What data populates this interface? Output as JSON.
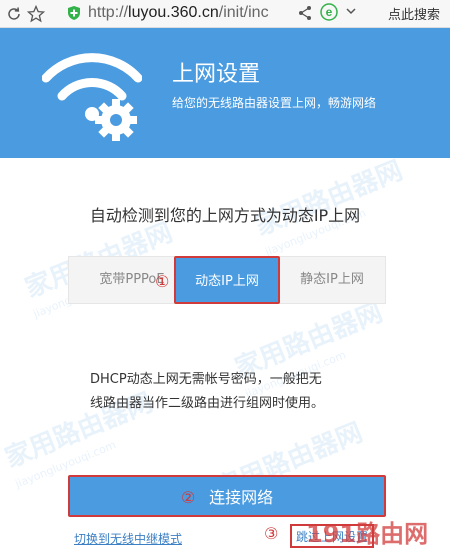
{
  "browser": {
    "url_prefix": "http://",
    "url_host": "luyou.360.cn",
    "url_path": "/init/inc",
    "search_label": "点此搜索",
    "engine_letter": "e"
  },
  "header": {
    "title": "上网设置",
    "subtitle": "给您的无线路由器设置上网，畅游网络"
  },
  "main": {
    "detect_title": "自动检测到您的上网方式为动态IP上网",
    "tabs": [
      {
        "label": "宽带PPPoE",
        "selected": false
      },
      {
        "label": "动态IP上网",
        "selected": true
      },
      {
        "label": "静态IP上网",
        "selected": false
      }
    ],
    "description_line1": "DHCP动态上网无需帐号密码，一般把无",
    "description_line2": "线路由器当作二级路由进行组网时使用。",
    "connect_label": "连接网络",
    "relay_link": "切换到无线中继模式",
    "skip_link": "跳过上网设置"
  },
  "annotations": {
    "marker1": "①",
    "marker2": "②",
    "marker3": "③"
  },
  "watermarks": {
    "site_cn": "家用路由器网",
    "site_pinyin": "jiayongluyouqi.com",
    "corner": "191路由网"
  },
  "colors": {
    "accent": "#4a9be0",
    "annotation_red": "#d03a3a",
    "link_blue": "#3b7fc4"
  }
}
